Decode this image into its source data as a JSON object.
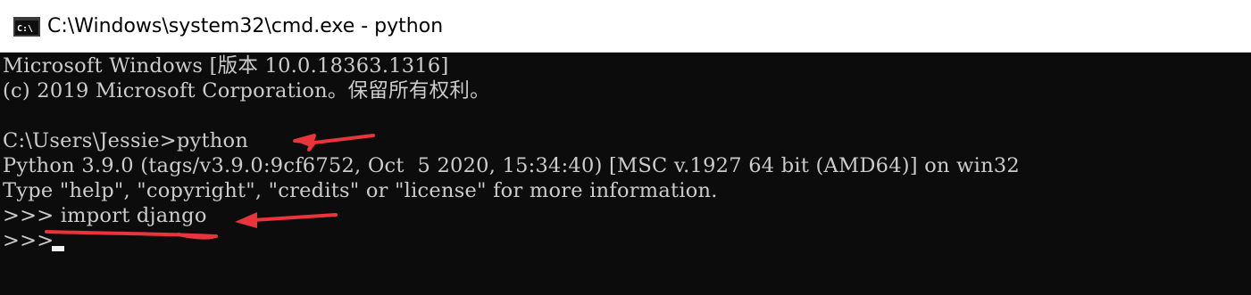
{
  "window": {
    "title": "C:\\Windows\\system32\\cmd.exe - python",
    "icon": "cmd-icon"
  },
  "console": {
    "lines": [
      "Microsoft Windows [版本 10.0.18363.1316]",
      "(c) 2019 Microsoft Corporation。保留所有权利。",
      "",
      "C:\\Users\\Jessie>python",
      "Python 3.9.0 (tags/v3.9.0:9cf6752, Oct  5 2020, 15:34:40) [MSC v.1927 64 bit (AMD64)] on win32",
      "Type \"help\", \"copyright\", \"credits\" or \"license\" for more information.",
      ">>> import django",
      ">>> "
    ]
  },
  "annotation": {
    "color": "#e8343a"
  }
}
